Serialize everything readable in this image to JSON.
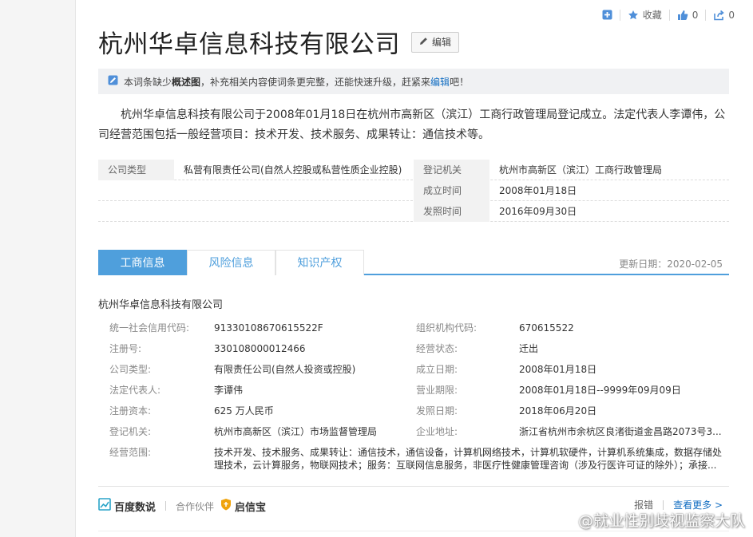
{
  "toolbar": {
    "favorite_label": "收藏",
    "like_count": "0",
    "share_count": "0"
  },
  "title": "杭州华卓信息科技有限公司",
  "edit_label": "编辑",
  "notice": {
    "prefix": "本词条缺少",
    "bold": "概述图",
    "middle": "，补充相关内容使词条更完整，还能快速升级，赶紧来",
    "link": "编辑",
    "suffix": "吧！"
  },
  "intro": "杭州华卓信息科技有限公司于2008年01月18日在杭州市高新区（滨江）工商行政管理局登记成立。法定代表人李谭伟，公司经营范围包括一般经营项目：技术开发、技术服务、成果转让：通信技术等。",
  "basic_info": {
    "company_type_label": "公司类型",
    "company_type_value": "私营有限责任公司(自然人控股或私营性质企业控股)",
    "reg_authority_label": "登记机关",
    "reg_authority_value": "杭州市高新区（滨江）工商行政管理局",
    "established_label": "成立时间",
    "established_value": "2008年01月18日",
    "license_label": "发照时间",
    "license_value": "2016年09月30日"
  },
  "tabs": [
    "工商信息",
    "风险信息",
    "知识产权"
  ],
  "update_date": "更新日期：2020-02-05",
  "company_name": "杭州华卓信息科技有限公司",
  "business_info": {
    "rows": [
      {
        "l1": "统一社会信用代码:",
        "v1": "91330108670615522F",
        "l2": "组织机构代码:",
        "v2": "670615522"
      },
      {
        "l1": "注册号:",
        "v1": "330108000012466",
        "l2": "经营状态:",
        "v2": "迁出"
      },
      {
        "l1": "公司类型:",
        "v1": "有限责任公司(自然人投资或控股)",
        "l2": "成立日期:",
        "v2": "2008年01月18日"
      },
      {
        "l1": "法定代表人:",
        "v1": "李谭伟",
        "l2": "营业期限:",
        "v2": "2008年01月18日--9999年09月09日"
      },
      {
        "l1": "注册资本:",
        "v1": "625 万人民币",
        "l2": "发照日期:",
        "v2": "2018年06月20日"
      },
      {
        "l1": "登记机关:",
        "v1": "杭州市高新区（滨江）市场监督管理局",
        "l2": "企业地址:",
        "v2": "浙江省杭州市余杭区良渚街道金昌路2073号3..."
      }
    ],
    "scope_label": "经营范围:",
    "scope_value": "技术开发、技术服务、成果转让：通信技术，通信设备，计算机网络技术，计算机软硬件，计算机系统集成，数据存储处理技术，云计算服务，物联网技术；服务：互联网信息服务，非医疗性健康管理咨询（涉及行医许可证的除外）；承接..."
  },
  "footer": {
    "brand": "百度数说",
    "partner_label": "合作伙伴",
    "partner_name": "启信宝",
    "report_label": "报错",
    "more_label": "查看更多 >"
  },
  "watermark": "@就业性别歧视监察大队",
  "colors": {
    "accent": "#4f9fdc",
    "link": "#136ec2"
  }
}
